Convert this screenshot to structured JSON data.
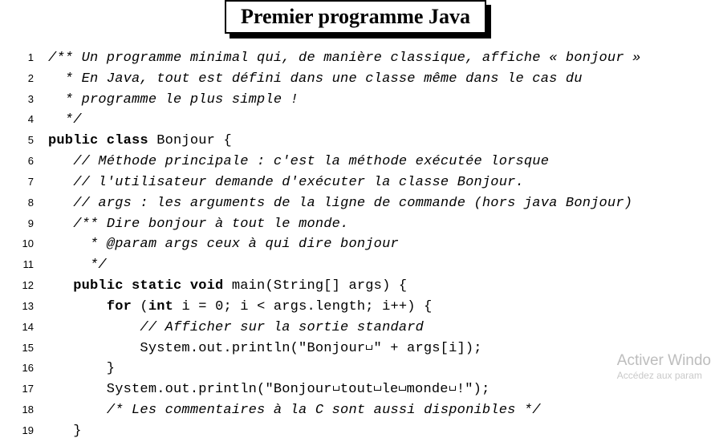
{
  "title": "Premier programme Java",
  "lines": [
    {
      "n": "1",
      "tokens": [
        {
          "t": "/** Un programme minimal qui, de manière classique, affiche « bonjour »",
          "cls": "comment"
        }
      ]
    },
    {
      "n": "2",
      "tokens": [
        {
          "t": "  * En Java, tout est défini dans une classe même dans le cas du",
          "cls": "comment"
        }
      ]
    },
    {
      "n": "3",
      "tokens": [
        {
          "t": "  * programme le plus simple !",
          "cls": "comment"
        }
      ]
    },
    {
      "n": "4",
      "tokens": [
        {
          "t": "  */",
          "cls": "comment"
        }
      ]
    },
    {
      "n": "5",
      "tokens": [
        {
          "t": "public class",
          "cls": "kw"
        },
        {
          "t": " Bonjour {",
          "cls": ""
        }
      ]
    },
    {
      "n": "6",
      "tokens": [
        {
          "t": "   ",
          "cls": ""
        },
        {
          "t": "// Méthode principale : c'est la méthode exécutée lorsque",
          "cls": "comment"
        }
      ]
    },
    {
      "n": "7",
      "tokens": [
        {
          "t": "   ",
          "cls": ""
        },
        {
          "t": "// l'utilisateur demande d'exécuter la classe Bonjour.",
          "cls": "comment"
        }
      ]
    },
    {
      "n": "8",
      "tokens": [
        {
          "t": "   ",
          "cls": ""
        },
        {
          "t": "// args : les arguments de la ligne de commande (hors java Bonjour)",
          "cls": "comment"
        }
      ]
    },
    {
      "n": "9",
      "tokens": [
        {
          "t": "   ",
          "cls": ""
        },
        {
          "t": "/** Dire bonjour à tout le monde.",
          "cls": "comment"
        }
      ]
    },
    {
      "n": "10",
      "tokens": [
        {
          "t": "     * @param args ceux à qui dire bonjour",
          "cls": "comment"
        }
      ]
    },
    {
      "n": "11",
      "tokens": [
        {
          "t": "     */",
          "cls": "comment"
        }
      ]
    },
    {
      "n": "12",
      "tokens": [
        {
          "t": "   ",
          "cls": ""
        },
        {
          "t": "public static void",
          "cls": "kw"
        },
        {
          "t": " main(String[] args) {",
          "cls": ""
        }
      ]
    },
    {
      "n": "13",
      "tokens": [
        {
          "t": "       ",
          "cls": ""
        },
        {
          "t": "for",
          "cls": "kw"
        },
        {
          "t": " (",
          "cls": ""
        },
        {
          "t": "int",
          "cls": "kw"
        },
        {
          "t": " i = 0; i < args.length; i++) {",
          "cls": ""
        }
      ]
    },
    {
      "n": "14",
      "tokens": [
        {
          "t": "           ",
          "cls": ""
        },
        {
          "t": "// Afficher sur la sortie standard",
          "cls": "comment"
        }
      ]
    },
    {
      "n": "15",
      "tokens": [
        {
          "t": "           System.out.println(\"Bonjour",
          "cls": ""
        },
        {
          "t": "",
          "cls": "vis"
        },
        {
          "t": "\" + args[i]);",
          "cls": ""
        }
      ]
    },
    {
      "n": "16",
      "tokens": [
        {
          "t": "       }",
          "cls": ""
        }
      ]
    },
    {
      "n": "17",
      "tokens": [
        {
          "t": "       System.out.println(\"Bonjour",
          "cls": ""
        },
        {
          "t": "",
          "cls": "vis"
        },
        {
          "t": "tout",
          "cls": ""
        },
        {
          "t": "",
          "cls": "vis"
        },
        {
          "t": "le",
          "cls": ""
        },
        {
          "t": "",
          "cls": "vis"
        },
        {
          "t": "monde",
          "cls": ""
        },
        {
          "t": "",
          "cls": "vis"
        },
        {
          "t": "!\");",
          "cls": ""
        }
      ]
    },
    {
      "n": "18",
      "tokens": [
        {
          "t": "       ",
          "cls": ""
        },
        {
          "t": "/* Les commentaires à la C sont aussi disponibles */",
          "cls": "comment"
        }
      ]
    },
    {
      "n": "19",
      "tokens": [
        {
          "t": "   }",
          "cls": ""
        }
      ]
    }
  ],
  "watermark": {
    "title": "Activer Windo",
    "sub": "Accédez aux param"
  }
}
